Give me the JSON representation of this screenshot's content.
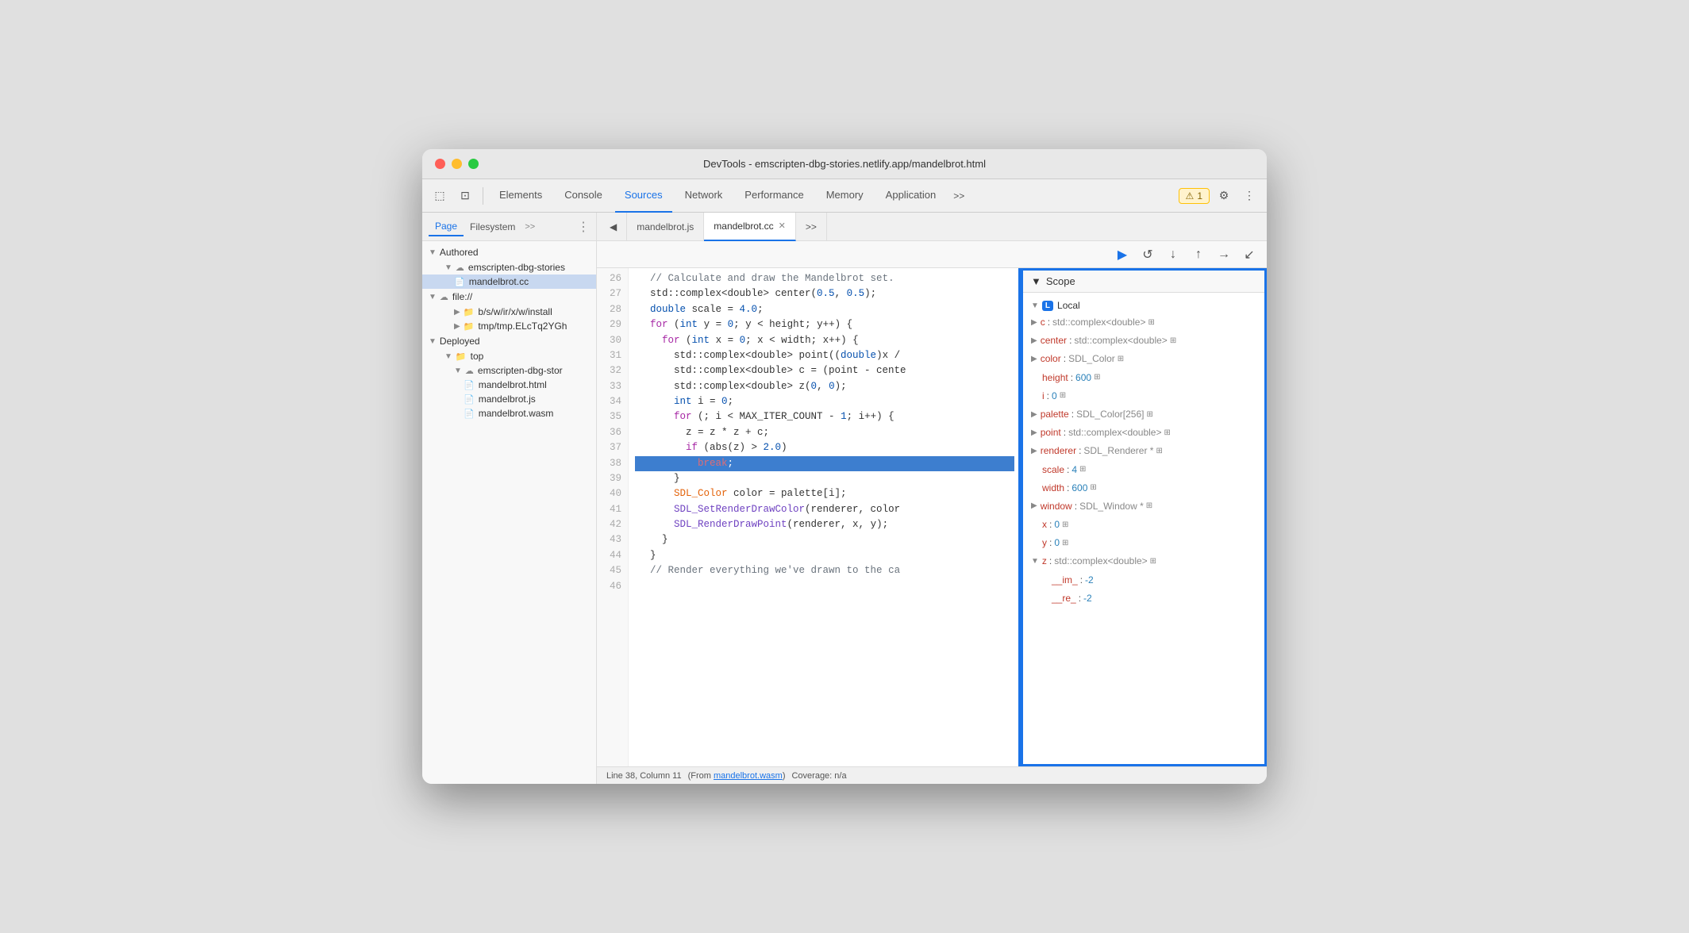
{
  "window": {
    "title": "DevTools - emscripten-dbg-stories.netlify.app/mandelbrot.html"
  },
  "toolbar": {
    "tabs": [
      {
        "label": "Elements",
        "active": false
      },
      {
        "label": "Console",
        "active": false
      },
      {
        "label": "Sources",
        "active": true
      },
      {
        "label": "Network",
        "active": false
      },
      {
        "label": "Performance",
        "active": false
      },
      {
        "label": "Memory",
        "active": false
      },
      {
        "label": "Application",
        "active": false
      }
    ],
    "more_label": ">>",
    "warning_count": "1",
    "warning_label": "⚠ 1"
  },
  "sidebar": {
    "tabs": [
      "Page",
      "Filesystem"
    ],
    "more_label": ">>",
    "tree": {
      "authored": {
        "label": "Authored",
        "children": [
          {
            "label": "emscripten-dbg-stories",
            "type": "cloud",
            "children": [
              {
                "label": "mandelbrot.cc",
                "type": "file-cc",
                "selected": true
              }
            ]
          }
        ]
      },
      "file": {
        "label": "file://",
        "type": "cloud",
        "children": [
          {
            "label": "b/s/w/ir/x/w/install",
            "type": "folder"
          },
          {
            "label": "tmp/tmp.ELcTq2YG",
            "type": "folder"
          }
        ]
      },
      "deployed": {
        "label": "Deployed",
        "children": [
          {
            "label": "top",
            "type": "folder",
            "children": [
              {
                "label": "emscripten-dbg-stor",
                "type": "cloud",
                "children": [
                  {
                    "label": "mandelbrot.html",
                    "type": "file-html"
                  },
                  {
                    "label": "mandelbrot.js",
                    "type": "file-js"
                  },
                  {
                    "label": "mandelbrot.wasm",
                    "type": "file-wasm"
                  }
                ]
              }
            ]
          }
        ]
      }
    }
  },
  "editor": {
    "tabs": [
      {
        "label": "mandelbrot.js",
        "active": false,
        "closable": false
      },
      {
        "label": "mandelbrot.cc",
        "active": true,
        "closable": true
      }
    ],
    "more_label": ">>",
    "code_lines": [
      {
        "num": 29,
        "text": "  // Calculate and draw the Mandelbrot set."
      },
      {
        "num": 26,
        "raw": "  // Calculate and draw the Mandelbrot set."
      },
      {
        "num": 27,
        "raw": "  std::complex<double> center(0.5, 0.5);"
      },
      {
        "num": 28,
        "raw": "  double scale = 4.0;"
      },
      {
        "num": 29,
        "raw": "  for (int y = 0; y < height; y++) {"
      },
      {
        "num": 30,
        "raw": "    for (int x = 0; x < width; x++) {"
      },
      {
        "num": 31,
        "raw": "      std::complex<double> point((double)x /"
      },
      {
        "num": 32,
        "raw": "      std::complex<double> c = (point - cente"
      },
      {
        "num": 33,
        "raw": "      std::complex<double> z(0, 0);"
      },
      {
        "num": 34,
        "raw": "      int i = 0;"
      },
      {
        "num": 35,
        "raw": "      for (; i < MAX_ITER_COUNT - 1; i++) {"
      },
      {
        "num": 36,
        "raw": "        z = z * z + c;"
      },
      {
        "num": 37,
        "raw": "        if (abs(z) > 2.0)"
      },
      {
        "num": 38,
        "raw": "          break;",
        "highlighted": true
      },
      {
        "num": 39,
        "raw": "      }"
      },
      {
        "num": 40,
        "raw": "      SDL_Color color = palette[i];"
      },
      {
        "num": 41,
        "raw": "      SDL_SetRenderDrawColor(renderer, color"
      },
      {
        "num": 42,
        "raw": "      SDL_RenderDrawPoint(renderer, x, y);"
      },
      {
        "num": 43,
        "raw": "    }"
      },
      {
        "num": 44,
        "raw": "  }"
      },
      {
        "num": 45,
        "raw": ""
      },
      {
        "num": 46,
        "raw": "  // Render everything we've drawn to the ca"
      }
    ],
    "statusbar": {
      "line_col": "Line 38, Column 11",
      "from_label": "(From ",
      "from_file": "mandelbrot.wasm",
      "from_end": ")",
      "coverage": "Coverage: n/a"
    }
  },
  "scope": {
    "header": "Scope",
    "sections": [
      {
        "label": "Local",
        "badge": "L",
        "expanded": true,
        "items": [
          {
            "key": "c",
            "colon": ":",
            "val": "std::complex<double>",
            "expandable": true,
            "grid": true
          },
          {
            "key": "center",
            "colon": ":",
            "val": "std::complex<double>",
            "expandable": true,
            "grid": true
          },
          {
            "key": "color",
            "colon": ":",
            "val": "SDL_Color",
            "expandable": true,
            "grid": true
          },
          {
            "key": "height",
            "colon": ":",
            "val": "600",
            "grid": true
          },
          {
            "key": "i",
            "colon": ":",
            "val": "0",
            "grid": true
          },
          {
            "key": "palette",
            "colon": ":",
            "val": "SDL_Color[256]",
            "expandable": true,
            "grid": true
          },
          {
            "key": "point",
            "colon": ":",
            "val": "std::complex<double>",
            "expandable": true,
            "grid": true
          },
          {
            "key": "renderer",
            "colon": ":",
            "val": "SDL_Renderer *",
            "expandable": true,
            "grid": true
          },
          {
            "key": "scale",
            "colon": ":",
            "val": "4",
            "grid": true
          },
          {
            "key": "width",
            "colon": ":",
            "val": "600",
            "grid": true
          },
          {
            "key": "window",
            "colon": ":",
            "val": "SDL_Window *",
            "expandable": true,
            "grid": true
          },
          {
            "key": "x",
            "colon": ":",
            "val": "0",
            "grid": true
          },
          {
            "key": "y",
            "colon": ":",
            "val": "0",
            "grid": true
          },
          {
            "key": "z",
            "colon": ":",
            "val": "std::complex<double>",
            "expandable": true,
            "grid": true,
            "expanded_sub": true
          },
          {
            "key": "__im_",
            "colon": ":",
            "val": "-2",
            "sub": true
          },
          {
            "key": "__re_",
            "colon": ":",
            "val": "-2",
            "sub": true
          }
        ]
      }
    ]
  }
}
